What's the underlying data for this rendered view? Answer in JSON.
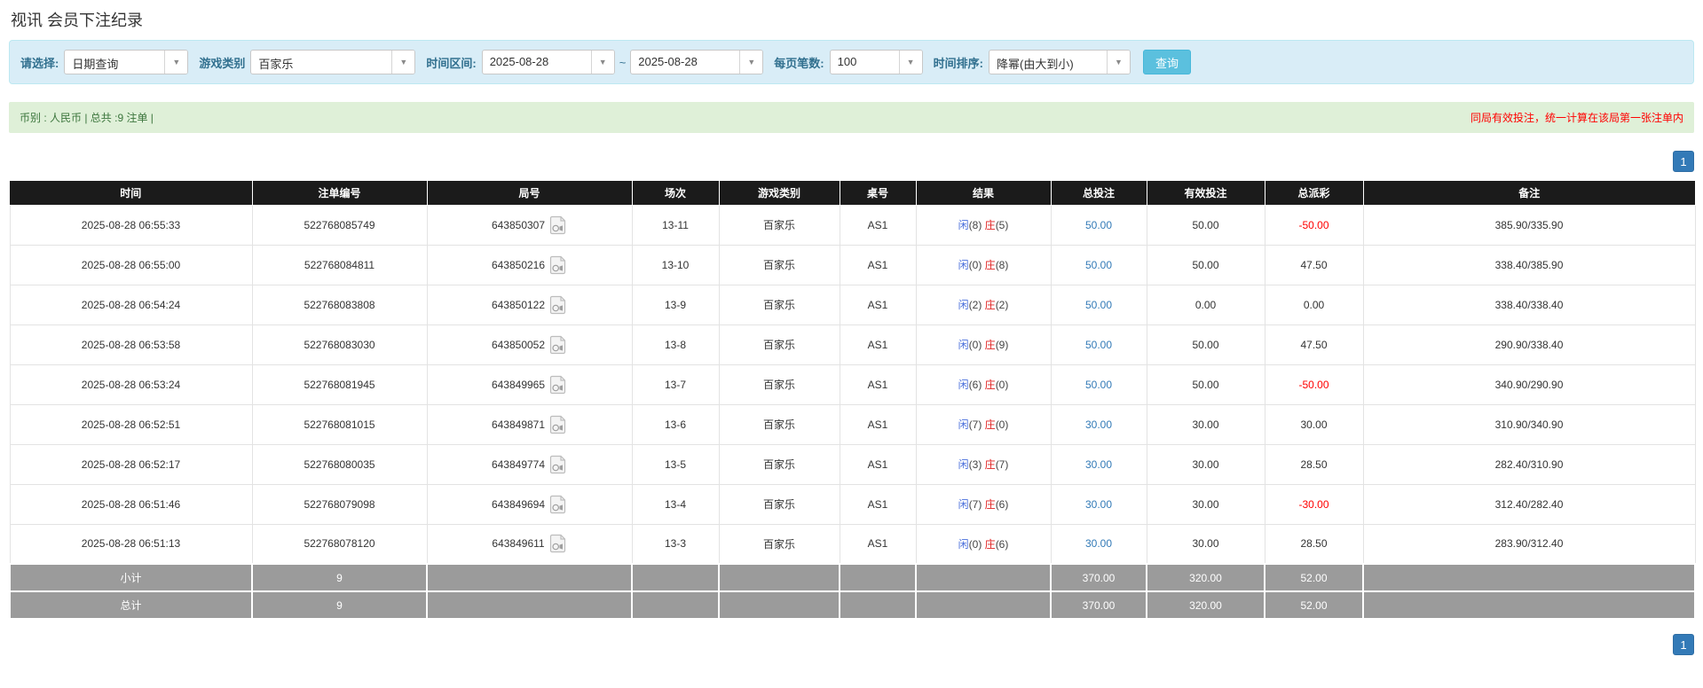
{
  "page": {
    "title": "视讯 会员下注纪录"
  },
  "filters": {
    "select_label": "请选择:",
    "query_type": "日期查询",
    "game_label": "游戏类别",
    "game_type": "百家乐",
    "range_label": "时间区间:",
    "date_from": "2025-08-28",
    "range_separator": "~",
    "date_to": "2025-08-28",
    "page_size_label": "每页笔数:",
    "page_size": "100",
    "sort_label": "时间排序:",
    "sort_order": "降幂(由大到小)",
    "query_button": "查询"
  },
  "summary_bar": {
    "left": "币别 : 人民币 | 总共 :9 注单 |",
    "notice": "同局有效投注，统一计算在该局第一张注单内"
  },
  "pagination": {
    "top": "1",
    "bottom": "1"
  },
  "colors": {
    "accent_blue": "#337ab7",
    "button_blue": "#5bc0de",
    "panel_blue": "#d9edf7",
    "bar_green": "#dff0d8",
    "text_green": "#3c763d",
    "notice_red": "#ff0000",
    "player_blue": "#4a6fdc",
    "banker_red": "#e02222",
    "header_black": "#1b1b1b",
    "footer_gray": "#9b9b9b"
  },
  "table": {
    "headers": [
      "时间",
      "注单编号",
      "局号",
      "场次",
      "游戏类别",
      "桌号",
      "结果",
      "总投注",
      "有效投注",
      "总派彩",
      "备注"
    ],
    "video_icon_name": "video-replay",
    "rows": [
      {
        "time": "2025-08-28 06:55:33",
        "bet_id": "522768085749",
        "round_id": "643850307",
        "session": "13-11",
        "game": "百家乐",
        "table_no": "AS1",
        "result_player_label": "闲",
        "result_player": "(8)",
        "result_banker_label": "庄",
        "result_banker": "(5)",
        "total_bet": "50.00",
        "valid_bet": "50.00",
        "payout": "-50.00",
        "note": "385.90/335.90"
      },
      {
        "time": "2025-08-28 06:55:00",
        "bet_id": "522768084811",
        "round_id": "643850216",
        "session": "13-10",
        "game": "百家乐",
        "table_no": "AS1",
        "result_player_label": "闲",
        "result_player": "(0)",
        "result_banker_label": "庄",
        "result_banker": "(8)",
        "total_bet": "50.00",
        "valid_bet": "50.00",
        "payout": "47.50",
        "note": "338.40/385.90"
      },
      {
        "time": "2025-08-28 06:54:24",
        "bet_id": "522768083808",
        "round_id": "643850122",
        "session": "13-9",
        "game": "百家乐",
        "table_no": "AS1",
        "result_player_label": "闲",
        "result_player": "(2)",
        "result_banker_label": "庄",
        "result_banker": "(2)",
        "total_bet": "50.00",
        "valid_bet": "0.00",
        "payout": "0.00",
        "note": "338.40/338.40"
      },
      {
        "time": "2025-08-28 06:53:58",
        "bet_id": "522768083030",
        "round_id": "643850052",
        "session": "13-8",
        "game": "百家乐",
        "table_no": "AS1",
        "result_player_label": "闲",
        "result_player": "(0)",
        "result_banker_label": "庄",
        "result_banker": "(9)",
        "total_bet": "50.00",
        "valid_bet": "50.00",
        "payout": "47.50",
        "note": "290.90/338.40"
      },
      {
        "time": "2025-08-28 06:53:24",
        "bet_id": "522768081945",
        "round_id": "643849965",
        "session": "13-7",
        "game": "百家乐",
        "table_no": "AS1",
        "result_player_label": "闲",
        "result_player": "(6)",
        "result_banker_label": "庄",
        "result_banker": "(0)",
        "total_bet": "50.00",
        "valid_bet": "50.00",
        "payout": "-50.00",
        "note": "340.90/290.90"
      },
      {
        "time": "2025-08-28 06:52:51",
        "bet_id": "522768081015",
        "round_id": "643849871",
        "session": "13-6",
        "game": "百家乐",
        "table_no": "AS1",
        "result_player_label": "闲",
        "result_player": "(7)",
        "result_banker_label": "庄",
        "result_banker": "(0)",
        "total_bet": "30.00",
        "valid_bet": "30.00",
        "payout": "30.00",
        "note": "310.90/340.90"
      },
      {
        "time": "2025-08-28 06:52:17",
        "bet_id": "522768080035",
        "round_id": "643849774",
        "session": "13-5",
        "game": "百家乐",
        "table_no": "AS1",
        "result_player_label": "闲",
        "result_player": "(3)",
        "result_banker_label": "庄",
        "result_banker": "(7)",
        "total_bet": "30.00",
        "valid_bet": "30.00",
        "payout": "28.50",
        "note": "282.40/310.90"
      },
      {
        "time": "2025-08-28 06:51:46",
        "bet_id": "522768079098",
        "round_id": "643849694",
        "session": "13-4",
        "game": "百家乐",
        "table_no": "AS1",
        "result_player_label": "闲",
        "result_player": "(7)",
        "result_banker_label": "庄",
        "result_banker": "(6)",
        "total_bet": "30.00",
        "valid_bet": "30.00",
        "payout": "-30.00",
        "note": "312.40/282.40"
      },
      {
        "time": "2025-08-28 06:51:13",
        "bet_id": "522768078120",
        "round_id": "643849611",
        "session": "13-3",
        "game": "百家乐",
        "table_no": "AS1",
        "result_player_label": "闲",
        "result_player": "(0)",
        "result_banker_label": "庄",
        "result_banker": "(6)",
        "total_bet": "30.00",
        "valid_bet": "30.00",
        "payout": "28.50",
        "note": "283.90/312.40"
      }
    ],
    "footer_rows": [
      {
        "cells": [
          "小计",
          "9",
          "",
          "",
          "",
          "",
          "",
          "370.00",
          "320.00",
          "52.00",
          ""
        ]
      },
      {
        "cells": [
          "总计",
          "9",
          "",
          "",
          "",
          "",
          "",
          "370.00",
          "320.00",
          "52.00",
          ""
        ]
      }
    ]
  }
}
